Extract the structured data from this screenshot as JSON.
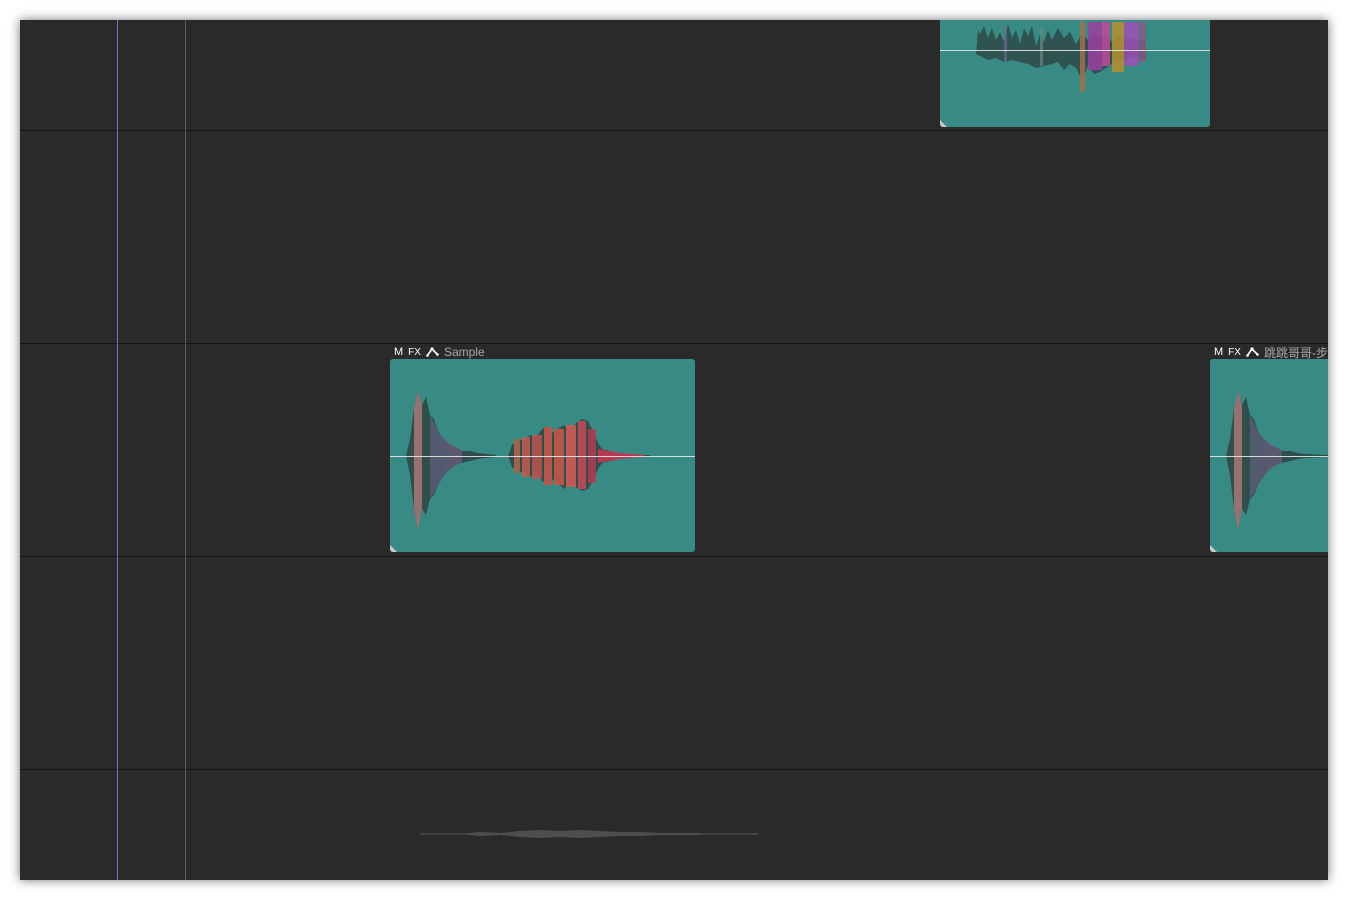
{
  "timeline": {
    "colors": {
      "background": "#2a2a2a",
      "clip": "#388a84",
      "playhead": "#7a74c9",
      "clip_name": "#a9a9a9"
    },
    "clips": [
      {
        "badges": {
          "mute": "M",
          "fx": "FX",
          "envelope": "envelope-icon"
        },
        "name": "Sample"
      },
      {
        "badges": {
          "mute": "M",
          "fx": "FX",
          "envelope": "envelope-icon"
        },
        "name": "跳跳哥哥-步"
      }
    ]
  }
}
